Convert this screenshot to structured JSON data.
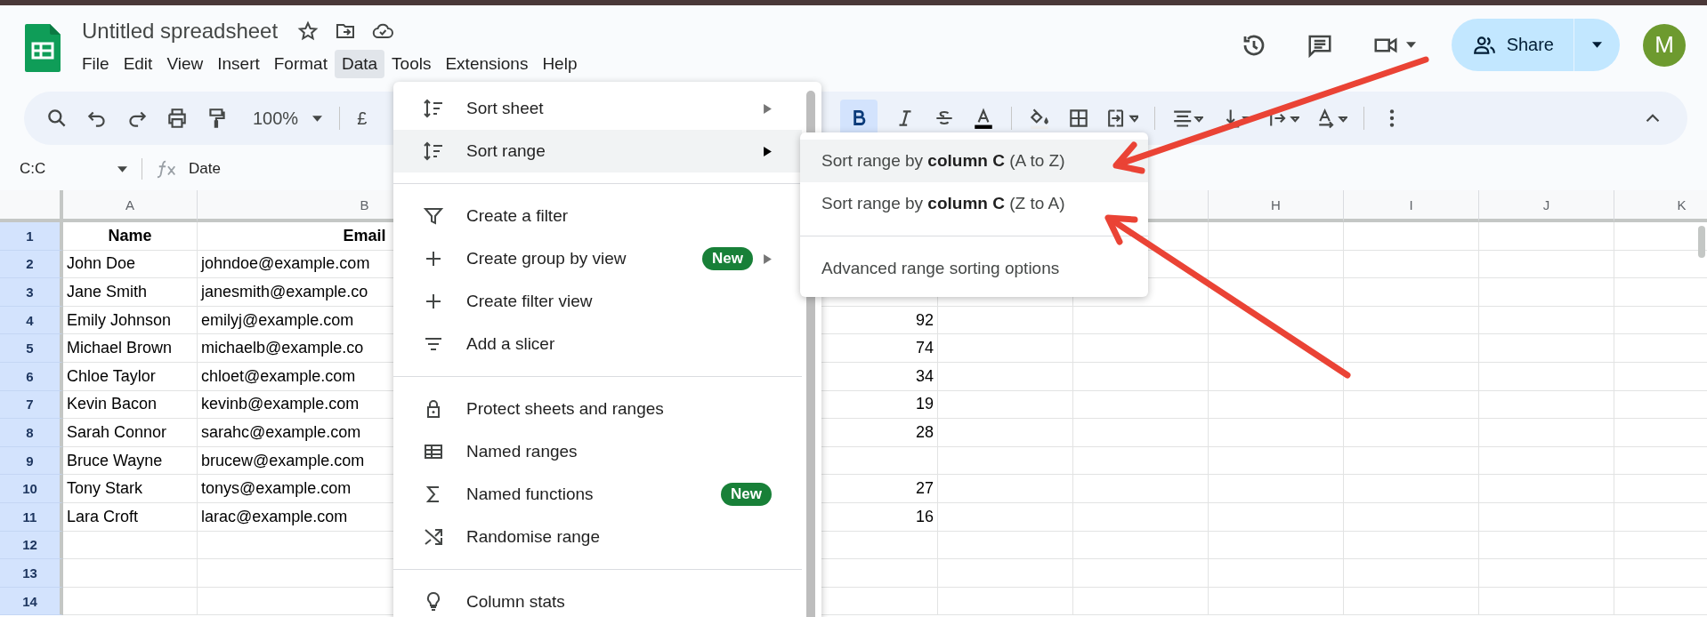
{
  "document": {
    "title": "Untitled spreadsheet"
  },
  "menu_bar": [
    {
      "label": "File",
      "selected": false
    },
    {
      "label": "Edit",
      "selected": false
    },
    {
      "label": "View",
      "selected": false
    },
    {
      "label": "Insert",
      "selected": false
    },
    {
      "label": "Format",
      "selected": false
    },
    {
      "label": "Data",
      "selected": true
    },
    {
      "label": "Tools",
      "selected": false
    },
    {
      "label": "Extensions",
      "selected": false
    },
    {
      "label": "Help",
      "selected": false
    }
  ],
  "share_button": {
    "label": "Share"
  },
  "avatar": {
    "initial": "M"
  },
  "toolbar": {
    "zoom": "100%",
    "currency": "£",
    "bold": true
  },
  "name_box": {
    "value": "C:C"
  },
  "formula_bar": {
    "value": "Date"
  },
  "sheet": {
    "column_headers": [
      "A",
      "B",
      "H",
      "I",
      "J",
      "K"
    ],
    "rows": [
      {
        "number": "1",
        "bold": true,
        "a": "Name",
        "b": "Email"
      },
      {
        "number": "2",
        "a": "John Doe",
        "b": "johndoe@example.com"
      },
      {
        "number": "3",
        "a": "Jane Smith",
        "b": "janesmith@example.co"
      },
      {
        "number": "4",
        "a": "Emily Johnson",
        "b": "emilyj@example.com",
        "e": "92"
      },
      {
        "number": "5",
        "a": "Michael Brown",
        "b": "michaelb@example.co",
        "e": "74"
      },
      {
        "number": "6",
        "a": "Chloe Taylor",
        "b": "chloet@example.com",
        "e": "34"
      },
      {
        "number": "7",
        "a": "Kevin Bacon",
        "b": "kevinb@example.com",
        "e": "19"
      },
      {
        "number": "8",
        "a": "Sarah Connor",
        "b": "sarahc@example.com",
        "e": "28"
      },
      {
        "number": "9",
        "a": "Bruce Wayne",
        "b": "brucew@example.com"
      },
      {
        "number": "10",
        "a": "Tony Stark",
        "b": "tonys@example.com",
        "e": "27"
      },
      {
        "number": "11",
        "a": "Lara Croft",
        "b": "larac@example.com",
        "e": "16"
      },
      {
        "number": "12"
      },
      {
        "number": "13"
      },
      {
        "number": "14"
      }
    ]
  },
  "data_menu": {
    "groups": [
      [
        {
          "label": "Sort sheet",
          "submenu": true,
          "selected": false
        },
        {
          "label": "Sort range",
          "submenu": true,
          "selected": true
        }
      ],
      [
        {
          "label": "Create a filter",
          "submenu": false,
          "selected": false
        },
        {
          "label": "Create group by view",
          "submenu": true,
          "badge": "New",
          "selected": false
        },
        {
          "label": "Create filter view",
          "submenu": false,
          "selected": false
        },
        {
          "label": "Add a slicer",
          "submenu": false,
          "selected": false
        }
      ],
      [
        {
          "label": "Protect sheets and ranges",
          "submenu": false,
          "selected": false
        },
        {
          "label": "Named ranges",
          "submenu": false,
          "selected": false
        },
        {
          "label": "Named functions",
          "submenu": false,
          "badge": "New",
          "selected": false
        },
        {
          "label": "Randomise range",
          "submenu": false,
          "selected": false
        }
      ],
      [
        {
          "label": "Column stats",
          "submenu": false,
          "selected": false
        }
      ]
    ]
  },
  "sort_submenu": {
    "groups": [
      [
        {
          "label": "Sort range by **column C** (A to Z)",
          "selected": true
        },
        {
          "label": "Sort range by **column C** (Z to A)",
          "selected": false
        }
      ],
      [
        {
          "label": "Advanced range sorting options",
          "selected": false
        }
      ]
    ]
  }
}
